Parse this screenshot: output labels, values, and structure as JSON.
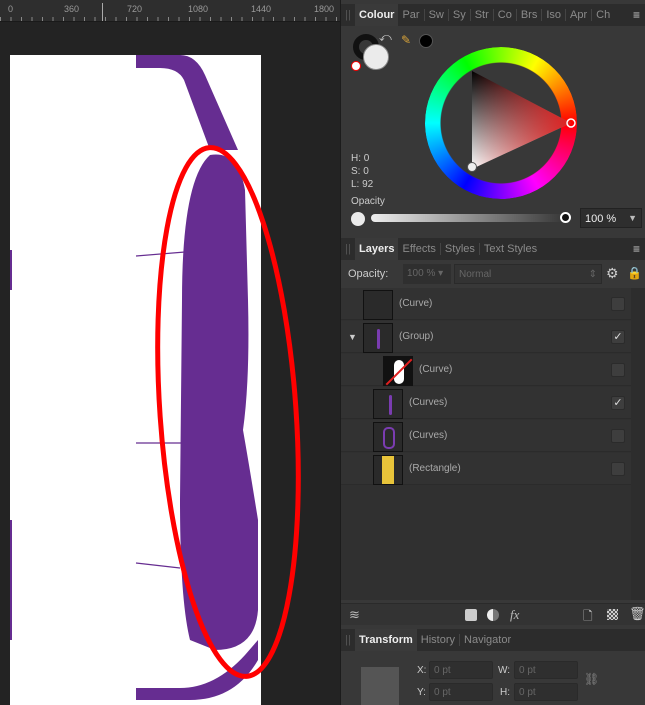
{
  "ruler": {
    "ticks": [
      "0",
      "360",
      "720",
      "1080",
      "1440",
      "1800"
    ]
  },
  "colour_panel": {
    "tabs": [
      "Colour",
      "Par",
      "Sw",
      "Sy",
      "Str",
      "Co",
      "Brs",
      "Iso",
      "Apr",
      "Ch"
    ],
    "hsl": {
      "h": "H: 0",
      "s": "S: 0",
      "l": "L: 92"
    },
    "opacity_label": "Opacity",
    "opacity_value": "100 %",
    "opacity_fraction": 1.0,
    "fill_color": "#ebebeb",
    "stroke_color": "#000000",
    "hue_color": "#e02020"
  },
  "layers_panel": {
    "tabs": [
      "Layers",
      "Effects",
      "Styles",
      "Text Styles"
    ],
    "opacity_label": "Opacity:",
    "opacity_value": "100 %",
    "blend_mode": "Normal",
    "layers": [
      {
        "name": "(Curve)",
        "checked": false
      },
      {
        "name": "(Group)",
        "checked": true,
        "expanded": true
      },
      {
        "name": "(Curve)",
        "checked": false
      },
      {
        "name": "(Curves)",
        "checked": true
      },
      {
        "name": "(Curves)",
        "checked": false
      },
      {
        "name": "(Rectangle)",
        "checked": false
      }
    ],
    "fx_label": "fx"
  },
  "transform_panel": {
    "tabs": [
      "Transform",
      "History",
      "Navigator"
    ],
    "x_label": "X:",
    "x_value": "0 pt",
    "y_label": "Y:",
    "y_value": "0 pt",
    "w_label": "W:",
    "w_value": "0 pt",
    "h_label": "H:",
    "h_value": "0 pt"
  },
  "colors": {
    "purple": "#662d91",
    "annotation_red": "#ff0000",
    "rectangle_yellow": "#e8c43a"
  }
}
